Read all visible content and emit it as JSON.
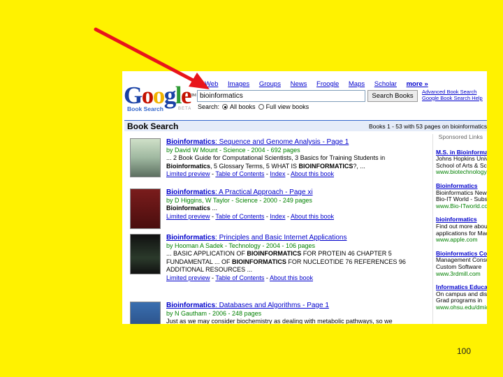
{
  "nav": [
    {
      "label": "Web"
    },
    {
      "label": "Images"
    },
    {
      "label": "Groups"
    },
    {
      "label": "News"
    },
    {
      "label": "Froogle"
    },
    {
      "label": "Maps"
    },
    {
      "label": "Scholar"
    },
    {
      "label": "more »"
    }
  ],
  "logo": {
    "text": "Google",
    "tm": "TM",
    "sub": "Book Search",
    "beta": "BETA"
  },
  "search": {
    "value": "bioinformatics",
    "button": "Search Books",
    "advanced": "Advanced Book Search",
    "help": "Google Book Search Help",
    "scope_label": "Search:",
    "scope_all": "All books",
    "scope_full": "Full view books"
  },
  "results_bar": {
    "title": "Book Search",
    "stats": "Books 1 - 53 with 53 pages on bioinformatics"
  },
  "results": [
    {
      "title_b": "Bioinformatics",
      "title_rest": ": Sequence and Genome Analysis - Page 1",
      "meta": "by David W Mount - Science - 2004 - 692 pages",
      "snippet_html": "... 2 Book Guide for Computational Scientists, 3 Basics for Training Students in <b>Bioinformatics</b>, 5 Glossary Terms, 5 WHAT IS <b>BIOINFORMATICS</b>?, ...",
      "links": [
        "Limited preview",
        "Table of Contents",
        "Index",
        "About this book"
      ]
    },
    {
      "title_b": "Bioinformatics",
      "title_rest": ": A Practical Approach - Page xi",
      "meta": "by D Higgins, W Taylor - Science - 2000 - 249 pages",
      "snippet_html": "<b>Bioinformatics</b> ...",
      "links": [
        "Limited preview",
        "Table of Contents",
        "Index",
        "About this book"
      ]
    },
    {
      "title_b": "Bioinformatics",
      "title_rest": ": Principles and Basic Internet Applications",
      "meta": "by Hooman A Sadek - Technology - 2004 - 106 pages",
      "snippet_html": "... BASIC APPLICATION OF <b>BIOINFORMATICS</b> FOR PROTEIN 46 CHAPTER 5 FUNDAMENTAL ... OF <b>BIOINFORMATICS</b> FOR NUCLEOTIDE 76 REFERENCES 96 ADDITIONAL RESOURCES ... ",
      "links": [
        "Limited preview",
        "Table of Contents",
        "About this book"
      ]
    },
    {
      "title_b": "Bioinformatics",
      "title_rest": ": Databases and Algorithms - Page 1",
      "meta": "by N Gautham - 2006 - 248 pages",
      "snippet_html": "Just as we may consider biochemistry as dealing with metabolic pathways, so we",
      "links": []
    }
  ],
  "ads": {
    "header": "Sponsored Links",
    "items": [
      {
        "title": "M.S. in Bioinformatics",
        "lines": [
          "Johns Hopkins University",
          "School of Arts & Sciences"
        ],
        "url": "www.biotechnology.jhu.edu"
      },
      {
        "title": "Bioinformatics",
        "lines": [
          "Bioinformatics News",
          "Bio-IT World - Subscribe"
        ],
        "url": "www.Bio-ITworld.com"
      },
      {
        "title": "bioinformatics",
        "lines": [
          "Find out more about",
          "applications for Mac"
        ],
        "url": "www.apple.com"
      },
      {
        "title": "Bioinformatics Company",
        "lines": [
          "Management Consulting",
          "Custom Software"
        ],
        "url": "www.3rdmill.com"
      },
      {
        "title": "Informatics Education",
        "lines": [
          "On campus and distance",
          "Grad programs in"
        ],
        "url": "www.ohsu.edu/dmice"
      }
    ]
  },
  "page_number": "100",
  "colors": {
    "background": "#FFF200",
    "arrow": "#E8141B",
    "link": "#0000CC",
    "url_green": "#008000"
  }
}
